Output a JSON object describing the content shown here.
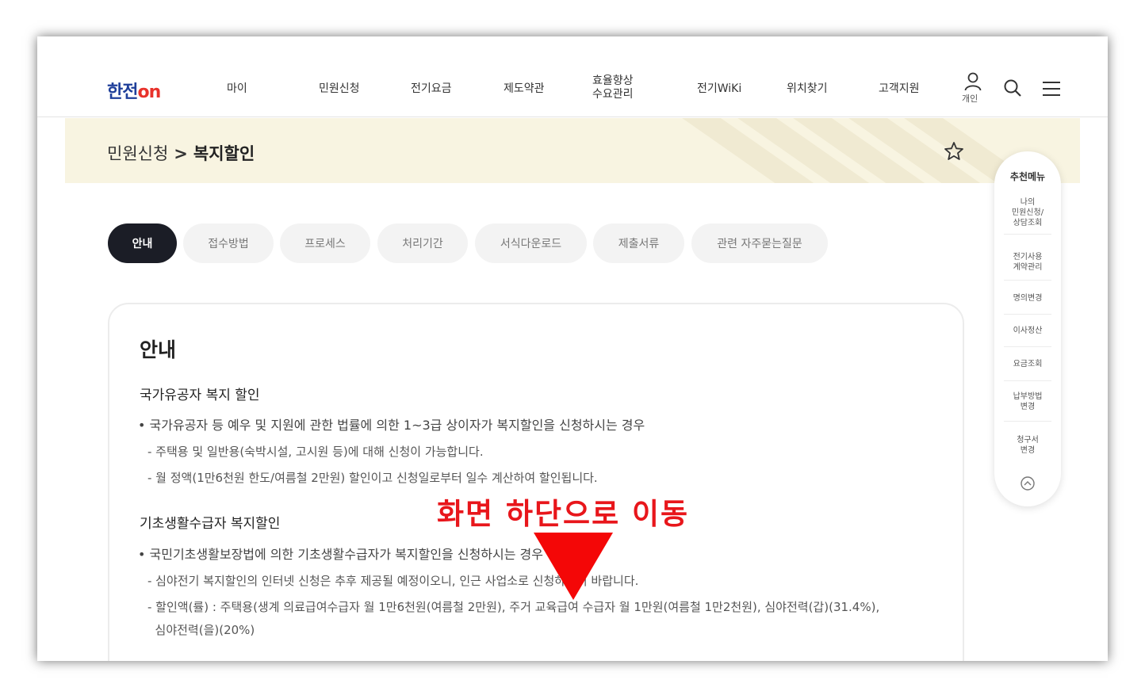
{
  "header": {
    "logo_main": "한전",
    "logo_on": "on",
    "nav": [
      "마이",
      "민원신청",
      "전기요금",
      "제도약관",
      "효율향상\n수요관리",
      "전기WiKi",
      "위치찾기",
      "고객지원"
    ],
    "user_label": "개인",
    "icons": [
      "person-icon",
      "search-icon",
      "menu-icon"
    ]
  },
  "breadcrumb": {
    "parent": "민원신청",
    "separator": ">",
    "current": "복지할인"
  },
  "tabs": [
    "안내",
    "접수방법",
    "프로세스",
    "처리기간",
    "서식다운로드",
    "제출서류",
    "관련 자주묻는질문"
  ],
  "content": {
    "title": "안내",
    "sections": [
      {
        "heading": "국가유공자 복지 할인",
        "bullet": "• 국가유공자 등 예우 및 지원에 관한 법률에 의한 1~3급 상이자가 복지할인을 신청하시는 경우",
        "subs": [
          "- 주택용 및 일반용(숙박시설, 고시원 등)에 대해 신청이 가능합니다.",
          "- 월 정액(1만6천원 한도/여름철 2만원) 할인이고 신청일로부터 일수 계산하여 할인됩니다."
        ]
      },
      {
        "heading": "기초생활수급자 복지할인",
        "bullet": "• 국민기초생활보장법에 의한 기초생활수급자가 복지할인을 신청하시는 경우",
        "subs": [
          "- 심야전기 복지할인의 인터넷 신청은 추후 제공될 예정이오니, 인근 사업소로 신청하시기 바랍니다.",
          "- 할인액(률) : 주택용(생계 의료급여수급자 월 1만6천원(여름철 2만원), 주거 교육급여 수급자 월 1만원(여름철 1만2천원), 심야전력(갑)(31.4%),",
          "  심야전력(을)(20%)"
        ]
      }
    ]
  },
  "annotation": {
    "text": "화면 하단으로 이동",
    "color": "#e8161b"
  },
  "quick_menu": {
    "title": "추천메뉴",
    "items": [
      "나의\n민원신청/\n상담조회",
      "전기사용\n계약관리",
      "명의변경",
      "이사정산",
      "요금조회",
      "납부방법\n변경",
      "청구서\n변경"
    ],
    "top_icon": "arrow-up-circle-icon"
  },
  "colors": {
    "brand_blue": "#1f3f9a",
    "brand_red": "#e8322b",
    "active_tab": "#1b1d26",
    "title_bg": "#f8f4e1"
  }
}
